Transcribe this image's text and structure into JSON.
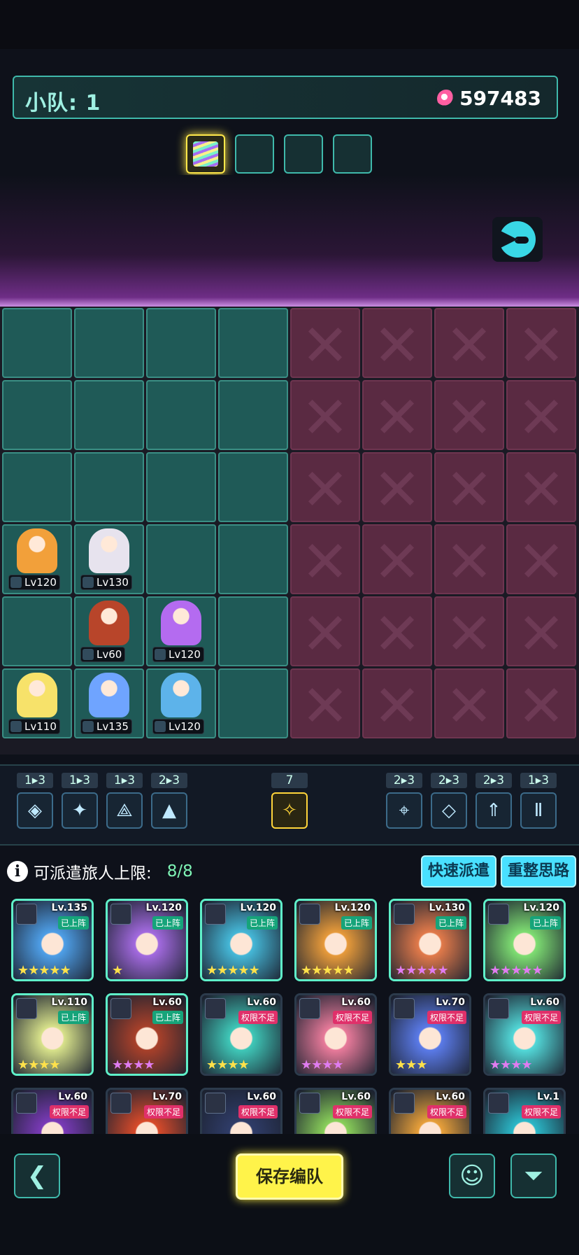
{
  "header": {
    "team_label": "小队: 1",
    "power": "597483"
  },
  "squad_slots": [
    {
      "active": true
    },
    {
      "active": false
    },
    {
      "active": false
    },
    {
      "active": false
    }
  ],
  "units": [
    {
      "level": "Lv120",
      "color": "#f2a03a",
      "col": 0,
      "row": 3
    },
    {
      "level": "Lv130",
      "color": "#e7e3ee",
      "col": 1,
      "row": 3
    },
    {
      "level": "Lv60",
      "color": "#b8452a",
      "col": 1,
      "row": 4
    },
    {
      "level": "Lv120",
      "color": "#b46bf0",
      "col": 2,
      "row": 4
    },
    {
      "level": "Lv110",
      "color": "#f7e26a",
      "col": 0,
      "row": 5
    },
    {
      "level": "Lv135",
      "color": "#6fa4ff",
      "col": 1,
      "row": 5
    },
    {
      "level": "Lv120",
      "color": "#5db3ea",
      "col": 2,
      "row": 5
    }
  ],
  "synergies_left": [
    {
      "count": "1▸3",
      "icon": "◈"
    },
    {
      "count": "1▸3",
      "icon": "✦"
    },
    {
      "count": "1▸3",
      "icon": "⟁"
    },
    {
      "count": "2▸3",
      "icon": "▲"
    }
  ],
  "synergy_center": {
    "count": "7",
    "icon": "✧"
  },
  "synergies_right": [
    {
      "count": "2▸3",
      "icon": "⌖"
    },
    {
      "count": "2▸3",
      "icon": "◇"
    },
    {
      "count": "2▸3",
      "icon": "⇑"
    },
    {
      "count": "1▸3",
      "icon": "Ⅱ"
    }
  ],
  "deploy_limit": {
    "label": "可派遣旅人上限:",
    "value": "8/8"
  },
  "buttons": {
    "quick": "快速派遣",
    "reset": "重整思路",
    "save": "保存编队"
  },
  "roster": [
    {
      "level": "Lv.135",
      "status": "已上阵",
      "stars": "★★★★★",
      "star_color": "#ffe14a",
      "color": "#4e9fe8"
    },
    {
      "level": "Lv.120",
      "status": "已上阵",
      "stars": "★",
      "star_color": "#ffe14a",
      "color": "#a36ae0"
    },
    {
      "level": "Lv.120",
      "status": "已上阵",
      "stars": "★★★★★",
      "star_color": "#ffe14a",
      "color": "#45b8d8"
    },
    {
      "level": "Lv.120",
      "status": "已上阵",
      "stars": "★★★★★",
      "star_color": "#ffe14a",
      "color": "#e79a3a"
    },
    {
      "level": "Lv.130",
      "status": "已上阵",
      "stars": "★★★★★",
      "star_color": "#e07cf0",
      "color": "#e27a4a"
    },
    {
      "level": "Lv.120",
      "status": "已上阵",
      "stars": "★★★★★",
      "star_color": "#e07cf0",
      "color": "#7ede72"
    },
    {
      "level": "Lv.110",
      "status": "已上阵",
      "stars": "★★★★",
      "star_color": "#ffe14a",
      "color": "#d8e28a"
    },
    {
      "level": "Lv.60",
      "status": "已上阵",
      "stars": "★★★★",
      "star_color": "#e07cf0",
      "color": "#a8402a"
    },
    {
      "level": "Lv.60",
      "status": "权限不足",
      "stars": "★★★★",
      "star_color": "#ffe14a",
      "color": "#3fc8b8"
    },
    {
      "level": "Lv.60",
      "status": "权限不足",
      "stars": "★★★★",
      "star_color": "#e07cf0",
      "color": "#e87a9a"
    },
    {
      "level": "Lv.70",
      "status": "权限不足",
      "stars": "★★★",
      "star_color": "#ffe14a",
      "color": "#5a7ae8"
    },
    {
      "level": "Lv.60",
      "status": "权限不足",
      "stars": "★★★★",
      "star_color": "#e07cf0",
      "color": "#52d8d8"
    },
    {
      "level": "Lv.60",
      "status": "权限不足",
      "stars": "",
      "star_color": "#ffe14a",
      "color": "#7a3ab8"
    },
    {
      "level": "Lv.70",
      "status": "权限不足",
      "stars": "",
      "star_color": "#ffe14a",
      "color": "#d84a2a"
    },
    {
      "level": "Lv.60",
      "status": "权限不足",
      "stars": "",
      "star_color": "#ffe14a",
      "color": "#2f3c68"
    },
    {
      "level": "Lv.60",
      "status": "权限不足",
      "stars": "",
      "star_color": "#ffe14a",
      "color": "#8ad05a"
    },
    {
      "level": "Lv.60",
      "status": "权限不足",
      "stars": "",
      "star_color": "#ffe14a",
      "color": "#e8a03a"
    },
    {
      "level": "Lv.1",
      "status": "权限不足",
      "stars": "",
      "star_color": "#ffe14a",
      "color": "#2bb8c8"
    }
  ]
}
